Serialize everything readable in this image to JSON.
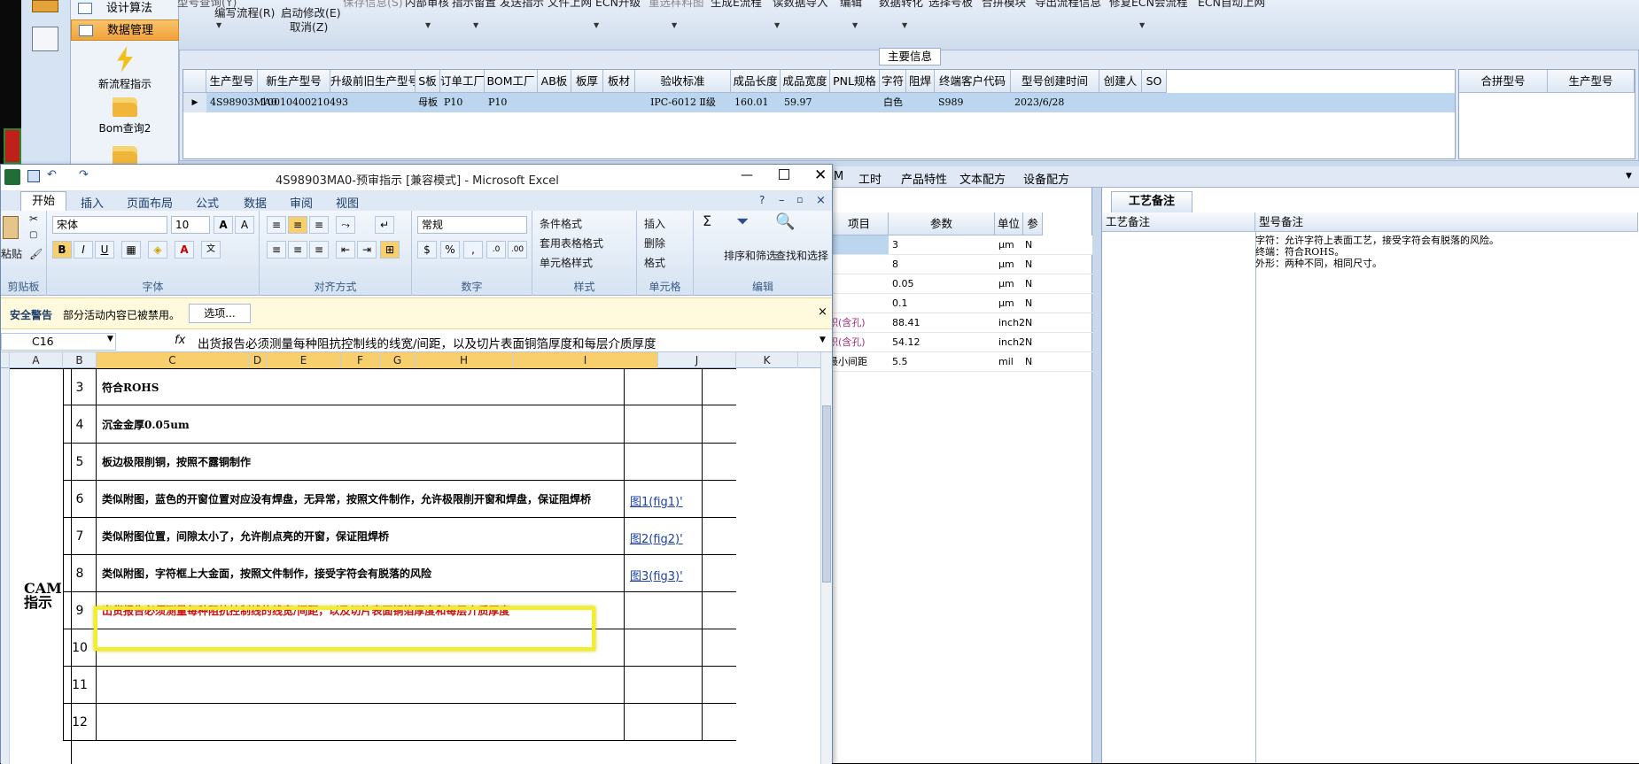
{
  "nav": {
    "items": [
      {
        "label": "设计算法",
        "selected": false
      },
      {
        "label": "数据管理",
        "selected": true
      }
    ],
    "big_buttons": [
      {
        "label": "新流程指示",
        "icon": "lightning-icon"
      },
      {
        "label": "Bom查询2",
        "icon": "folder-icon"
      }
    ]
  },
  "toolbar": {
    "top_row": [
      "型号查询(Y)",
      "保存信息(S)",
      "内部审核",
      "指示留置",
      "发送指示",
      "文件上网",
      "ECN升级",
      "重选样料图",
      "生成E流程",
      "读数据导入",
      "编辑",
      "数据转化",
      "选择号板",
      "合拼模块",
      "导出流程信息",
      "修复ECN会流程",
      "ECN自动上网"
    ],
    "write_flow": "编写流程(R)",
    "start_modify": "启动修改(E)",
    "cancel": "取消(Z)"
  },
  "main_info": {
    "title": "主要信息",
    "columns": [
      "生产型号",
      "新生产型号",
      "升级前旧生产型号",
      "S板",
      "订单工厂",
      "BOM工厂",
      "AB板",
      "板厚",
      "板材",
      "验收标准",
      "成品长度",
      "成品宽度",
      "PNL规格",
      "字符",
      "阻焊",
      "终端客户代码",
      "型号创建时间",
      "创建人",
      "SO"
    ],
    "row": [
      "4S98903MA0",
      "10010400210493",
      "",
      "母板",
      "P10",
      "P10",
      "",
      "",
      "",
      "IPC-6012 Ⅱ级",
      "160.01",
      "59.97",
      "",
      "白色",
      "",
      "S989",
      "2023/6/28",
      "",
      ""
    ],
    "side_columns": [
      "合拼型号",
      "生产型号"
    ]
  },
  "tabs": [
    "M",
    "工时",
    "产品特性",
    "文本配方",
    "设备配方"
  ],
  "params": {
    "columns": [
      "项目",
      "参数",
      "单位",
      "参"
    ],
    "rows": [
      {
        "name": "",
        "value": "3",
        "unit": "μm",
        "flag": "N"
      },
      {
        "name": "",
        "value": "8",
        "unit": "μm",
        "flag": "N"
      },
      {
        "name": "",
        "value": "0.05",
        "unit": "μm",
        "flag": "N"
      },
      {
        "name": "",
        "value": "0.1",
        "unit": "μm",
        "flag": "N"
      },
      {
        "name": "积(含孔)",
        "value": "88.41",
        "unit": "inch2",
        "flag": "N"
      },
      {
        "name": "积(含孔)",
        "value": "54.12",
        "unit": "inch2",
        "flag": "N"
      },
      {
        "name": "最小间距",
        "value": "5.5",
        "unit": "mil",
        "flag": "N"
      }
    ]
  },
  "craft": {
    "tab": "工艺备注",
    "col1": "工艺备注",
    "col2": "型号备注",
    "remark_lines": [
      "字符：允许字符上表面工艺，接受字符会有脱落的风险。",
      "终端：符合ROHS。",
      "外形：两种不同，相同尺寸。"
    ]
  },
  "excel": {
    "title": "4S98903MA0-预审指示  [兼容模式] - Microsoft Excel",
    "tabs": [
      "开始",
      "插入",
      "页面布局",
      "公式",
      "数据",
      "审阅",
      "视图"
    ],
    "font_name": "宋体",
    "font_size": "10",
    "number_format": "常规",
    "groups": [
      "剪贴板",
      "字体",
      "对齐方式",
      "数字",
      "样式",
      "单元格",
      "编辑"
    ],
    "paste": "粘贴",
    "style_buttons": [
      "条件格式",
      "套用表格格式",
      "单元格样式"
    ],
    "cell_buttons": [
      "插入",
      "删除",
      "格式"
    ],
    "edit_buttons": [
      "排序和筛选",
      "查找和选择"
    ],
    "security_label": "安全警告",
    "security_msg": "部分活动内容已被禁用。",
    "security_btn": "选项...",
    "namebox": "C16",
    "formula": "出货报告必须测量每种阻抗控制线的线宽/间距，以及切片表面铜箔厚度和每层介质厚度",
    "columns": [
      "A",
      "B",
      "C",
      "D",
      "E",
      "F",
      "G",
      "H",
      "I",
      "J",
      "K"
    ],
    "cam_label": "CAM 指示",
    "rows": [
      {
        "num": "3",
        "text": "符合ROHS",
        "link": ""
      },
      {
        "num": "4",
        "text": "沉金金厚0.05um",
        "link": ""
      },
      {
        "num": "5",
        "text": "板边极限削铜，按照不露铜制作",
        "link": ""
      },
      {
        "num": "6",
        "text": "类似附图，蓝色的开窗位置对应没有焊盘，无异常，按照文件制作，允许极限削开窗和焊盘，保证阻焊桥",
        "link": "图1(fig1)'"
      },
      {
        "num": "7",
        "text": "类似附图位置，间隙太小了，允许削点亮的开窗，保证阻焊桥",
        "link": "图2(fig2)'"
      },
      {
        "num": "8",
        "text": "类似附图，字符框上大金面，按照文件制作，接受字符会有脱落的风险",
        "link": "图3(fig3)'"
      },
      {
        "num": "9",
        "text": "出货报告必须测量每种阻抗控制线的线宽/间距，以及切片表面铜箔厚度和每层介质厚度",
        "link": "",
        "red": true
      },
      {
        "num": "10",
        "text": "",
        "link": ""
      },
      {
        "num": "11",
        "text": "",
        "link": ""
      },
      {
        "num": "12",
        "text": "",
        "link": ""
      }
    ]
  }
}
